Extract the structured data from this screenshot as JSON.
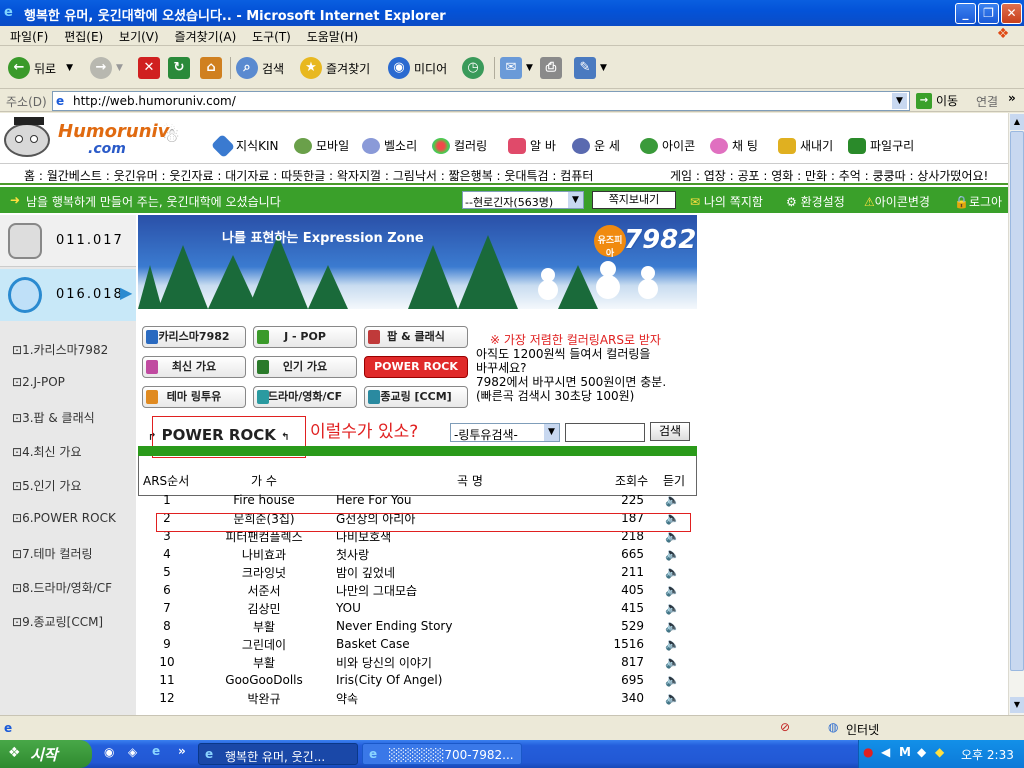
{
  "window": {
    "title": "행복한 유머, 웃긴대학에 오셨습니다.. - Microsoft Internet Explorer"
  },
  "menu": [
    "파일(F)",
    "편집(E)",
    "보기(V)",
    "즐겨찾기(A)",
    "도구(T)",
    "도움말(H)"
  ],
  "toolbar": {
    "back": "뒤로",
    "search": "검색",
    "favorites": "즐겨찾기",
    "media": "미디어"
  },
  "address": {
    "label": "주소(D)",
    "url": "http://web.humoruniv.com/",
    "go": "이동",
    "links": "연결"
  },
  "site": {
    "logo_top": "Humoruniv",
    "logo_bottom": ".com",
    "nav": [
      "지식KIN",
      "모바일",
      "벨소리",
      "컬러링",
      "알 바",
      "운 세",
      "아이콘",
      "채 팅",
      "새내기",
      "파일구리"
    ],
    "categories_left": "홈 : 월간베스트 : 웃긴유머 : 웃긴자료 : 대기자료 : 따뜻한글 : 왁자지껄 : 그림낙서 : 짧은행복 : 웃대특검 : 컴퓨터",
    "categories_right": "게임 : 엽장 : 공포 : 영화 : 만화 : 추억 : 쿵쿵따 : 상사가떴어요!",
    "greenbar": {
      "text": "남을 행복하게 만들어 주는, 웃긴대학에 오셨습니다",
      "users": "--현로긴자(563명)",
      "note_btn": "쪽지보내기",
      "links": [
        "나의 쪽지함",
        "환경설정",
        "아이콘변경",
        "로그아웃"
      ]
    },
    "phones": [
      "011.017",
      "016.018"
    ],
    "sidebar": [
      "1.카리스마7982",
      "2.J-POP",
      "3.팝 & 클래식",
      "4.최신 가요",
      "5.인기 가요",
      "6.POWER ROCK",
      "7.테마 컬러링",
      "8.드라마/영화/CF",
      "9.종교링[CCM]"
    ],
    "banner": {
      "title": "나를 표현하는 Expression Zone",
      "badge_top": "유즈피아",
      "badge_num": "7982"
    },
    "cat_buttons": [
      "카리스마7982",
      "J - POP",
      "팝 & 클래식",
      "최신 가요",
      "인기 가요",
      "POWER ROCK",
      "테마 링투유",
      "드라마/영화/CF",
      "종교링 [CCM]"
    ],
    "promo": {
      "headline": "※ 가장 저렴한 컬러링ARS로 받자",
      "body": [
        "아직도 1200원씩 들여서 컬러링을",
        "바꾸세요?",
        "7982에서 바꾸시면 500원이면 충분.",
        "(빠른곡 검색시 30초당 100원)"
      ]
    },
    "section_title": "POWER ROCK",
    "annotation": "이럴수가 있소?",
    "search": {
      "select": "-링투유검색-",
      "button": "검색",
      "input": ""
    },
    "table": {
      "headers": [
        "ARS순서",
        "가 수",
        "곡 명",
        "조회수",
        "듣기"
      ],
      "rows": [
        [
          "1",
          "Fire house",
          "Here For You",
          "225"
        ],
        [
          "2",
          "문희준(3집)",
          "G선상의 아리아",
          "187"
        ],
        [
          "3",
          "피터팬컴플렉스",
          "나비보호색",
          "218"
        ],
        [
          "4",
          "나비효과",
          "첫사랑",
          "665"
        ],
        [
          "5",
          "크라잉넛",
          "밤이 깊었네",
          "211"
        ],
        [
          "6",
          "서준서",
          "나만의 그대모습",
          "405"
        ],
        [
          "7",
          "김상민",
          "YOU",
          "415"
        ],
        [
          "8",
          "부활",
          "Never Ending Story",
          "529"
        ],
        [
          "9",
          "그린데이",
          "Basket Case",
          "1516"
        ],
        [
          "10",
          "부활",
          "비와 당신의 이야기",
          "817"
        ],
        [
          "11",
          "GooGooDolls",
          "Iris(City Of Angel)",
          "695"
        ],
        [
          "12",
          "박완규",
          "약속",
          "340"
        ]
      ]
    }
  },
  "status": {
    "zone": "인터넷"
  },
  "taskbar": {
    "start": "시작",
    "tasks": [
      "행복한 유머, 웃긴...",
      "░░░░░░700-7982..."
    ],
    "clock": "오후 2:33"
  }
}
